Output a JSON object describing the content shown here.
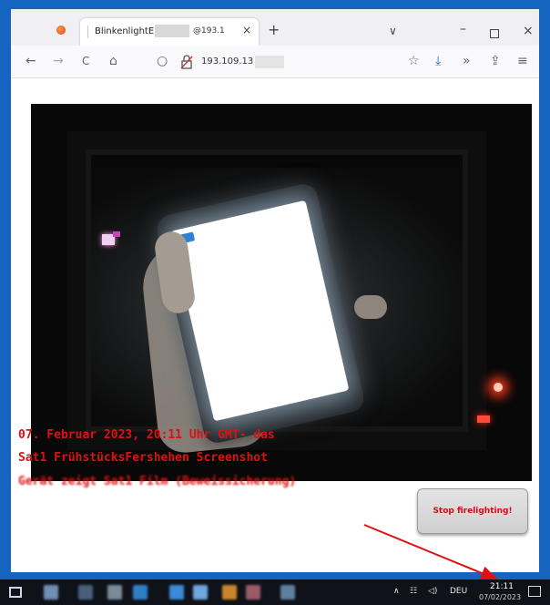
{
  "browser": {
    "tab_title": "BlinkenlightER",
    "tab_title_tail": "@193.1",
    "tab_close": "×",
    "new_tab": "+",
    "tab_list": "∨",
    "win_min": "–",
    "win_close": "×",
    "url": "193.109.13",
    "nav": {
      "back": "←",
      "forward": "→",
      "reload": "C",
      "home": "⌂",
      "shield": "○",
      "bookmark": "☆",
      "download": "⤓",
      "overflow": "»",
      "share": "⇪",
      "menu": "≡"
    }
  },
  "page": {
    "stop_button": "Stop firelighting!",
    "caption_line1": "07. Februar 2023, 20:11 Uhr GMT- das",
    "caption_line2": "Sat1 FrühstücksFershehen Screenshot",
    "caption_line3": "Gerät zeigt Sat1 Film (Beweissicherung)"
  },
  "taskbar": {
    "tray_caret": "∧",
    "tray_network": "☷",
    "tray_volume": "◁)",
    "tray_lang": "DEU",
    "time": "21:11",
    "date": "07/02/2023"
  },
  "colors": {
    "frame_blue": "#1565c0",
    "annotation_red": "#e01010",
    "taskbar": "#10121a"
  }
}
